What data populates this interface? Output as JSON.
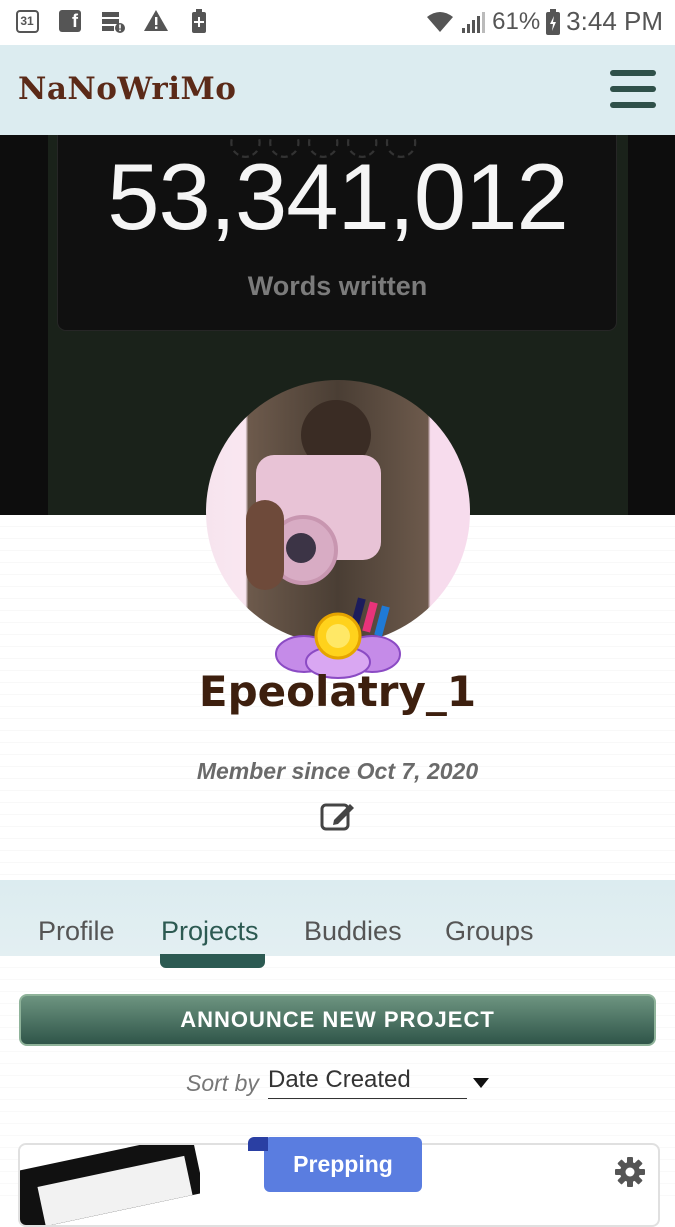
{
  "status_bar": {
    "calendar_day": "31",
    "facebook_glyph": "f",
    "battery_percent": "61%",
    "time": "3:44 PM",
    "icons": [
      "calendar-icon",
      "facebook-icon",
      "server-alert-icon",
      "warning-icon",
      "battery-saver-icon",
      "wifi-icon",
      "signal-icon",
      "battery-icon"
    ]
  },
  "header": {
    "logo": "NaNoWriMo",
    "menu_icon": "hamburger-icon"
  },
  "hero": {
    "word_count": "53,341,012",
    "words_label": "Words written"
  },
  "profile": {
    "username": "Epeolatry_1",
    "member_since": "Member since Oct 7, 2020",
    "edit_icon": "edit-icon"
  },
  "tabs": [
    {
      "label": "Profile",
      "active": false
    },
    {
      "label": "Projects",
      "active": true
    },
    {
      "label": "Buddies",
      "active": false
    },
    {
      "label": "Groups",
      "active": false
    }
  ],
  "projects": {
    "announce_label": "ANNOUNCE NEW PROJECT",
    "sort_label": "Sort by",
    "sort_value": "Date Created",
    "cards": [
      {
        "status": "Prepping",
        "settings_icon": "gear-icon"
      }
    ]
  },
  "colors": {
    "header_bg": "#dcecf0",
    "logo": "#5b2a18",
    "accent": "#2c5a52",
    "status_pill": "#5a7de0",
    "username": "#3d1f0e"
  }
}
